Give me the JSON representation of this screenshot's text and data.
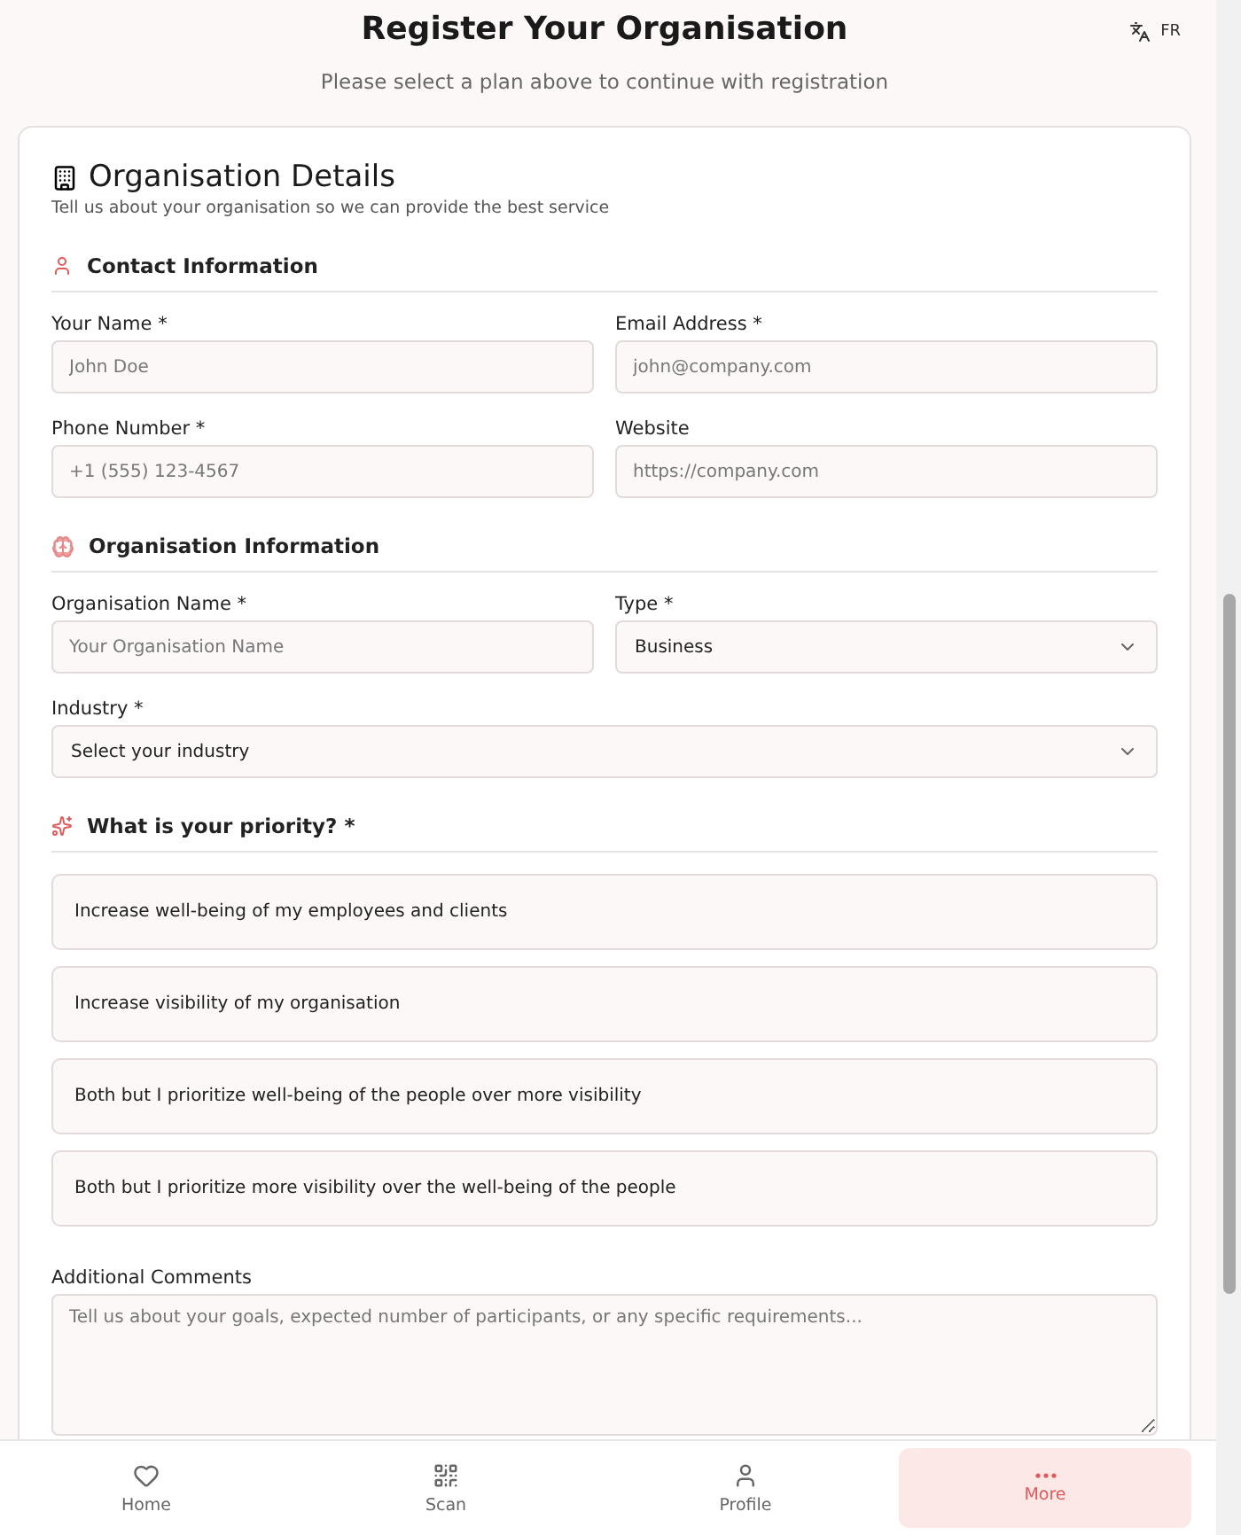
{
  "header": {
    "title": "Register Your Organisation",
    "subtitle": "Please select a plan above to continue with registration",
    "language": "FR"
  },
  "card": {
    "title": "Organisation Details",
    "subtitle": "Tell us about your organisation so we can provide the best service",
    "sections": [
      {
        "kind": "contact",
        "title": "Contact Information",
        "fields": [
          {
            "kind": "text",
            "label": "Your Name *",
            "placeholder": "John Doe"
          },
          {
            "kind": "text",
            "label": "Email Address *",
            "placeholder": "john@company.com"
          },
          {
            "kind": "text",
            "label": "Phone Number *",
            "placeholder": "+1 (555) 123-4567"
          },
          {
            "kind": "text",
            "label": "Website",
            "placeholder": "https://company.com"
          }
        ]
      },
      {
        "kind": "organisation",
        "title": "Organisation Information",
        "fields": [
          {
            "kind": "text",
            "label": "Organisation Name *",
            "placeholder": "Your Organisation Name"
          },
          {
            "kind": "select",
            "label": "Type *",
            "value": "Business"
          },
          {
            "kind": "select",
            "label": "Industry *",
            "value": "Select your industry"
          }
        ]
      },
      {
        "kind": "priority",
        "title": "What is your priority? *",
        "options": [
          {
            "label": "Increase well-being of my employees and clients",
            "selected": false
          },
          {
            "label": "Increase visibility of my organisation",
            "selected": false
          },
          {
            "label": "Both but I prioritize well-being of the people over more visibility",
            "selected": false
          },
          {
            "label": "Both but I prioritize more visibility over the well-being of the people",
            "selected": false
          }
        ]
      }
    ],
    "comments": {
      "label": "Additional Comments",
      "placeholder": "Tell us about your goals, expected number of participants, or any specific requirements..."
    }
  },
  "nav": [
    {
      "kind": "home",
      "label": "Home",
      "selected": false
    },
    {
      "kind": "scan",
      "label": "Scan",
      "selected": false
    },
    {
      "kind": "profile",
      "label": "Profile",
      "selected": false
    },
    {
      "kind": "more",
      "label": "More",
      "selected": true
    }
  ]
}
